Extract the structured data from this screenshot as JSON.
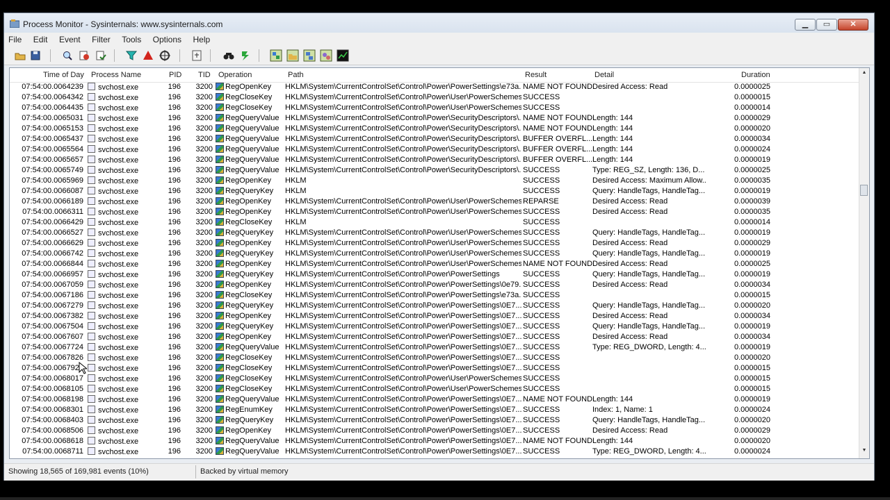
{
  "window": {
    "title": "Process Monitor - Sysinternals: www.sysinternals.com"
  },
  "menu": [
    "File",
    "Edit",
    "Event",
    "Filter",
    "Tools",
    "Options",
    "Help"
  ],
  "columns": {
    "time": "Time of Day",
    "process": "Process Name",
    "pid": "PID",
    "tid": "TID",
    "operation": "Operation",
    "path": "Path",
    "result": "Result",
    "detail": "Detail",
    "duration": "Duration"
  },
  "rows": [
    {
      "time": "07:54:00.0064239",
      "process": "svchost.exe",
      "pid": "196",
      "tid": "3200",
      "op": "RegOpenKey",
      "path": "HKLM\\System\\CurrentControlSet\\Control\\Power\\PowerSettings\\e73a...",
      "result": "NAME NOT FOUND",
      "detail": "Desired Access: Read",
      "duration": "0.0000025"
    },
    {
      "time": "07:54:00.0064342",
      "process": "svchost.exe",
      "pid": "196",
      "tid": "3200",
      "op": "RegCloseKey",
      "path": "HKLM\\System\\CurrentControlSet\\Control\\Power\\User\\PowerSchemes",
      "result": "SUCCESS",
      "detail": "",
      "duration": "0.0000015"
    },
    {
      "time": "07:54:00.0064435",
      "process": "svchost.exe",
      "pid": "196",
      "tid": "3200",
      "op": "RegCloseKey",
      "path": "HKLM\\System\\CurrentControlSet\\Control\\Power\\User\\PowerSchemes...",
      "result": "SUCCESS",
      "detail": "",
      "duration": "0.0000014"
    },
    {
      "time": "07:54:00.0065031",
      "process": "svchost.exe",
      "pid": "196",
      "tid": "3200",
      "op": "RegQueryValue",
      "path": "HKLM\\System\\CurrentControlSet\\Control\\Power\\SecurityDescriptors\\...",
      "result": "NAME NOT FOUND",
      "detail": "Length: 144",
      "duration": "0.0000029"
    },
    {
      "time": "07:54:00.0065153",
      "process": "svchost.exe",
      "pid": "196",
      "tid": "3200",
      "op": "RegQueryValue",
      "path": "HKLM\\System\\CurrentControlSet\\Control\\Power\\SecurityDescriptors\\...",
      "result": "NAME NOT FOUND",
      "detail": "Length: 144",
      "duration": "0.0000020"
    },
    {
      "time": "07:54:00.0065437",
      "process": "svchost.exe",
      "pid": "196",
      "tid": "3200",
      "op": "RegQueryValue",
      "path": "HKLM\\System\\CurrentControlSet\\Control\\Power\\SecurityDescriptors\\...",
      "result": "BUFFER OVERFL...",
      "detail": "Length: 144",
      "duration": "0.0000034"
    },
    {
      "time": "07:54:00.0065564",
      "process": "svchost.exe",
      "pid": "196",
      "tid": "3200",
      "op": "RegQueryValue",
      "path": "HKLM\\System\\CurrentControlSet\\Control\\Power\\SecurityDescriptors\\...",
      "result": "BUFFER OVERFL...",
      "detail": "Length: 144",
      "duration": "0.0000024"
    },
    {
      "time": "07:54:00.0065657",
      "process": "svchost.exe",
      "pid": "196",
      "tid": "3200",
      "op": "RegQueryValue",
      "path": "HKLM\\System\\CurrentControlSet\\Control\\Power\\SecurityDescriptors\\...",
      "result": "BUFFER OVERFL...",
      "detail": "Length: 144",
      "duration": "0.0000019"
    },
    {
      "time": "07:54:00.0065749",
      "process": "svchost.exe",
      "pid": "196",
      "tid": "3200",
      "op": "RegQueryValue",
      "path": "HKLM\\System\\CurrentControlSet\\Control\\Power\\SecurityDescriptors\\...",
      "result": "SUCCESS",
      "detail": "Type: REG_SZ, Length: 136, D...",
      "duration": "0.0000025"
    },
    {
      "time": "07:54:00.0065969",
      "process": "svchost.exe",
      "pid": "196",
      "tid": "3200",
      "op": "RegOpenKey",
      "path": "HKLM",
      "result": "SUCCESS",
      "detail": "Desired Access: Maximum Allow...",
      "duration": "0.0000035"
    },
    {
      "time": "07:54:00.0066087",
      "process": "svchost.exe",
      "pid": "196",
      "tid": "3200",
      "op": "RegQueryKey",
      "path": "HKLM",
      "result": "SUCCESS",
      "detail": "Query: HandleTags, HandleTag...",
      "duration": "0.0000019"
    },
    {
      "time": "07:54:00.0066189",
      "process": "svchost.exe",
      "pid": "196",
      "tid": "3200",
      "op": "RegOpenKey",
      "path": "HKLM\\System\\CurrentControlSet\\Control\\Power\\User\\PowerSchemes",
      "result": "REPARSE",
      "detail": "Desired Access: Read",
      "duration": "0.0000039"
    },
    {
      "time": "07:54:00.0066311",
      "process": "svchost.exe",
      "pid": "196",
      "tid": "3200",
      "op": "RegOpenKey",
      "path": "HKLM\\System\\CurrentControlSet\\Control\\Power\\User\\PowerSchemes",
      "result": "SUCCESS",
      "detail": "Desired Access: Read",
      "duration": "0.0000035"
    },
    {
      "time": "07:54:00.0066429",
      "process": "svchost.exe",
      "pid": "196",
      "tid": "3200",
      "op": "RegCloseKey",
      "path": "HKLM",
      "result": "SUCCESS",
      "detail": "",
      "duration": "0.0000014"
    },
    {
      "time": "07:54:00.0066527",
      "process": "svchost.exe",
      "pid": "196",
      "tid": "3200",
      "op": "RegQueryKey",
      "path": "HKLM\\System\\CurrentControlSet\\Control\\Power\\User\\PowerSchemes",
      "result": "SUCCESS",
      "detail": "Query: HandleTags, HandleTag...",
      "duration": "0.0000019"
    },
    {
      "time": "07:54:00.0066629",
      "process": "svchost.exe",
      "pid": "196",
      "tid": "3200",
      "op": "RegOpenKey",
      "path": "HKLM\\System\\CurrentControlSet\\Control\\Power\\User\\PowerSchemes...",
      "result": "SUCCESS",
      "detail": "Desired Access: Read",
      "duration": "0.0000029"
    },
    {
      "time": "07:54:00.0066742",
      "process": "svchost.exe",
      "pid": "196",
      "tid": "3200",
      "op": "RegQueryKey",
      "path": "HKLM\\System\\CurrentControlSet\\Control\\Power\\User\\PowerSchemes...",
      "result": "SUCCESS",
      "detail": "Query: HandleTags, HandleTag...",
      "duration": "0.0000019"
    },
    {
      "time": "07:54:00.0066844",
      "process": "svchost.exe",
      "pid": "196",
      "tid": "3200",
      "op": "RegOpenKey",
      "path": "HKLM\\System\\CurrentControlSet\\Control\\Power\\User\\PowerSchemes...",
      "result": "NAME NOT FOUND",
      "detail": "Desired Access: Read",
      "duration": "0.0000025"
    },
    {
      "time": "07:54:00.0066957",
      "process": "svchost.exe",
      "pid": "196",
      "tid": "3200",
      "op": "RegQueryKey",
      "path": "HKLM\\System\\CurrentControlSet\\Control\\Power\\PowerSettings",
      "result": "SUCCESS",
      "detail": "Query: HandleTags, HandleTag...",
      "duration": "0.0000019"
    },
    {
      "time": "07:54:00.0067059",
      "process": "svchost.exe",
      "pid": "196",
      "tid": "3200",
      "op": "RegOpenKey",
      "path": "HKLM\\System\\CurrentControlSet\\Control\\Power\\PowerSettings\\0e79...",
      "result": "SUCCESS",
      "detail": "Desired Access: Read",
      "duration": "0.0000034"
    },
    {
      "time": "07:54:00.0067186",
      "process": "svchost.exe",
      "pid": "196",
      "tid": "3200",
      "op": "RegCloseKey",
      "path": "HKLM\\System\\CurrentControlSet\\Control\\Power\\PowerSettings\\e73a...",
      "result": "SUCCESS",
      "detail": "",
      "duration": "0.0000015"
    },
    {
      "time": "07:54:00.0067279",
      "process": "svchost.exe",
      "pid": "196",
      "tid": "3200",
      "op": "RegQueryKey",
      "path": "HKLM\\System\\CurrentControlSet\\Control\\Power\\PowerSettings\\0E7...",
      "result": "SUCCESS",
      "detail": "Query: HandleTags, HandleTag...",
      "duration": "0.0000020"
    },
    {
      "time": "07:54:00.0067382",
      "process": "svchost.exe",
      "pid": "196",
      "tid": "3200",
      "op": "RegOpenKey",
      "path": "HKLM\\System\\CurrentControlSet\\Control\\Power\\PowerSettings\\0E7...",
      "result": "SUCCESS",
      "detail": "Desired Access: Read",
      "duration": "0.0000034"
    },
    {
      "time": "07:54:00.0067504",
      "process": "svchost.exe",
      "pid": "196",
      "tid": "3200",
      "op": "RegQueryKey",
      "path": "HKLM\\System\\CurrentControlSet\\Control\\Power\\PowerSettings\\0E7...",
      "result": "SUCCESS",
      "detail": "Query: HandleTags, HandleTag...",
      "duration": "0.0000019"
    },
    {
      "time": "07:54:00.0067607",
      "process": "svchost.exe",
      "pid": "196",
      "tid": "3200",
      "op": "RegOpenKey",
      "path": "HKLM\\System\\CurrentControlSet\\Control\\Power\\PowerSettings\\0E7...",
      "result": "SUCCESS",
      "detail": "Desired Access: Read",
      "duration": "0.0000034"
    },
    {
      "time": "07:54:00.0067724",
      "process": "svchost.exe",
      "pid": "196",
      "tid": "3200",
      "op": "RegQueryValue",
      "path": "HKLM\\System\\CurrentControlSet\\Control\\Power\\PowerSettings\\0E7...",
      "result": "SUCCESS",
      "detail": "Type: REG_DWORD, Length: 4...",
      "duration": "0.0000019"
    },
    {
      "time": "07:54:00.0067826",
      "process": "svchost.exe",
      "pid": "196",
      "tid": "3200",
      "op": "RegCloseKey",
      "path": "HKLM\\System\\CurrentControlSet\\Control\\Power\\PowerSettings\\0E7...",
      "result": "SUCCESS",
      "detail": "",
      "duration": "0.0000020"
    },
    {
      "time": "07:54:00.0067924",
      "process": "svchost.exe",
      "pid": "196",
      "tid": "3200",
      "op": "RegCloseKey",
      "path": "HKLM\\System\\CurrentControlSet\\Control\\Power\\PowerSettings\\0E7...",
      "result": "SUCCESS",
      "detail": "",
      "duration": "0.0000015"
    },
    {
      "time": "07:54:00.0068017",
      "process": "svchost.exe",
      "pid": "196",
      "tid": "3200",
      "op": "RegCloseKey",
      "path": "HKLM\\System\\CurrentControlSet\\Control\\Power\\User\\PowerSchemes",
      "result": "SUCCESS",
      "detail": "",
      "duration": "0.0000015"
    },
    {
      "time": "07:54:00.0068105",
      "process": "svchost.exe",
      "pid": "196",
      "tid": "3200",
      "op": "RegCloseKey",
      "path": "HKLM\\System\\CurrentControlSet\\Control\\Power\\User\\PowerSchemes...",
      "result": "SUCCESS",
      "detail": "",
      "duration": "0.0000015"
    },
    {
      "time": "07:54:00.0068198",
      "process": "svchost.exe",
      "pid": "196",
      "tid": "3200",
      "op": "RegQueryValue",
      "path": "HKLM\\System\\CurrentControlSet\\Control\\Power\\PowerSettings\\0E7...",
      "result": "NAME NOT FOUND",
      "detail": "Length: 144",
      "duration": "0.0000019"
    },
    {
      "time": "07:54:00.0068301",
      "process": "svchost.exe",
      "pid": "196",
      "tid": "3200",
      "op": "RegEnumKey",
      "path": "HKLM\\System\\CurrentControlSet\\Control\\Power\\PowerSettings\\0E7...",
      "result": "SUCCESS",
      "detail": "Index: 1, Name: 1",
      "duration": "0.0000024"
    },
    {
      "time": "07:54:00.0068403",
      "process": "svchost.exe",
      "pid": "196",
      "tid": "3200",
      "op": "RegQueryKey",
      "path": "HKLM\\System\\CurrentControlSet\\Control\\Power\\PowerSettings\\0E7...",
      "result": "SUCCESS",
      "detail": "Query: HandleTags, HandleTag...",
      "duration": "0.0000020"
    },
    {
      "time": "07:54:00.0068506",
      "process": "svchost.exe",
      "pid": "196",
      "tid": "3200",
      "op": "RegOpenKey",
      "path": "HKLM\\System\\CurrentControlSet\\Control\\Power\\PowerSettings\\0E7...",
      "result": "SUCCESS",
      "detail": "Desired Access: Read",
      "duration": "0.0000029"
    },
    {
      "time": "07:54:00.0068618",
      "process": "svchost.exe",
      "pid": "196",
      "tid": "3200",
      "op": "RegQueryValue",
      "path": "HKLM\\System\\CurrentControlSet\\Control\\Power\\PowerSettings\\0E7...",
      "result": "NAME NOT FOUND",
      "detail": "Length: 144",
      "duration": "0.0000020"
    },
    {
      "time": "07:54:00.0068711",
      "process": "svchost.exe",
      "pid": "196",
      "tid": "3200",
      "op": "RegQueryValue",
      "path": "HKLM\\System\\CurrentControlSet\\Control\\Power\\PowerSettings\\0E7...",
      "result": "SUCCESS",
      "detail": "Type: REG_DWORD, Length: 4...",
      "duration": "0.0000024"
    }
  ],
  "status": {
    "events": "Showing 18,565 of 169,981 events (10%)",
    "backing": "Backed by virtual memory"
  },
  "toolbar_icons": [
    "open-icon",
    "save-icon",
    "magnifier-icon",
    "autoscroll-icon",
    "clear-icon",
    "filter-icon",
    "highlight-icon",
    "target-icon",
    "jump-icon",
    "find-icon",
    "jump-to-icon",
    "registry-activity-icon",
    "filesystem-activity-icon",
    "network-activity-icon",
    "process-activity-icon",
    "profiling-activity-icon"
  ]
}
